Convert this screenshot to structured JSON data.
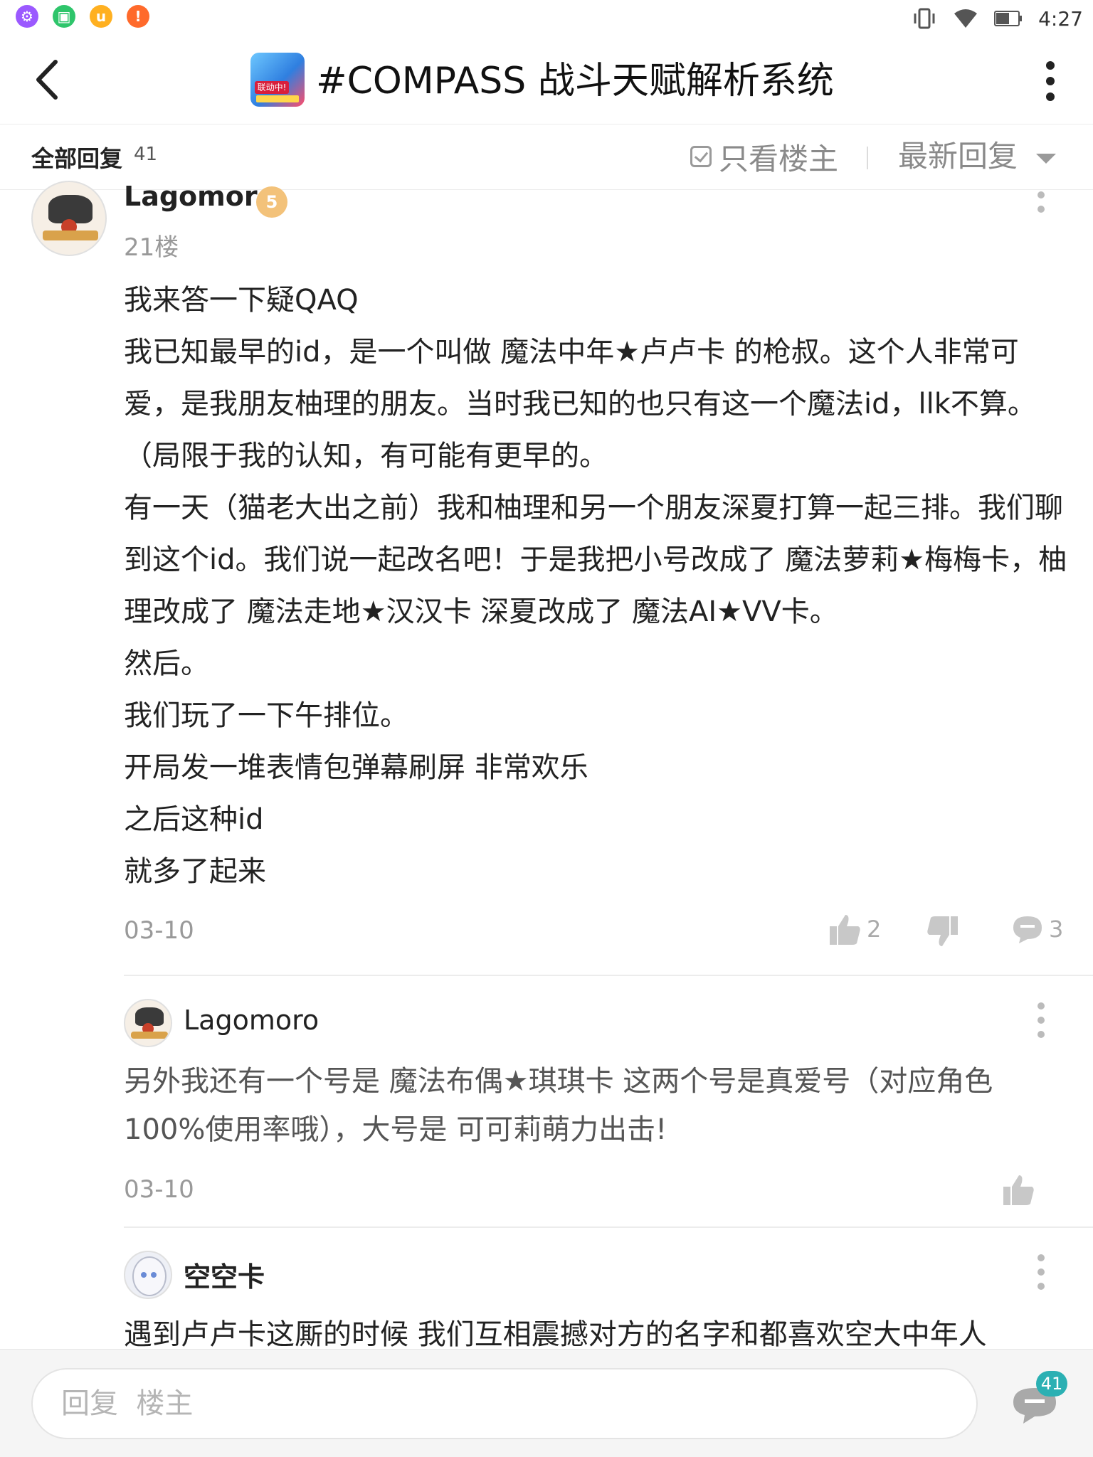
{
  "status_bar": {
    "time": "4:27"
  },
  "header": {
    "title": "#COMPASS 战斗天赋解析系统",
    "app_icon_text": "联动中!"
  },
  "tabs": {
    "all_replies_label": "全部回复",
    "all_replies_count": "41",
    "op_only_label": "只看楼主",
    "sort_label": "最新回复"
  },
  "post": {
    "username": "Lagomoro",
    "level": "5",
    "floor": "21楼",
    "lines": [
      "我来答一下疑QAQ",
      "我已知最早的id，是一个叫做 魔法中年★卢卢卡 的枪叔。这个人非常可爱，是我朋友柚理的朋友。当时我已知的也只有这一个魔法id，llk不算。（局限于我的认知，有可能有更早的。",
      "有一天（猫老大出之前）我和柚理和另一个朋友深夏打算一起三排。我们聊到这个id。我们说一起改名吧！于是我把小号改成了 魔法萝莉★梅梅卡，柚理改成了 魔法走地★汉汉卡 深夏改成了 魔法AI★VV卡。",
      "然后。",
      "我们玩了一下午排位。",
      "开局发一堆表情包弹幕刷屏 非常欢乐",
      "之后这种id",
      "就多了起来"
    ],
    "date": "03-10",
    "like_count": "2",
    "comment_count": "3"
  },
  "replies": [
    {
      "username": "Lagomoro",
      "text": "另外我还有一个号是 魔法布偶★琪琪卡 这两个号是真爱号（对应角色100%使用率哦），大号是 可可莉萌力出击!",
      "date": "03-10"
    },
    {
      "username": "空空卡",
      "text": "遇到卢卢卡这厮的时候 我们互相震撼对方的名字和都喜欢空大中年人",
      "date": ""
    }
  ],
  "bottom_bar": {
    "reply_placeholder": "回复  楼主",
    "comment_badge": "41"
  },
  "colors": {
    "accent_teal": "#2bb0b3",
    "muted_gray": "#999999",
    "text_dark": "#222222",
    "level_badge": "#f3c27a"
  }
}
